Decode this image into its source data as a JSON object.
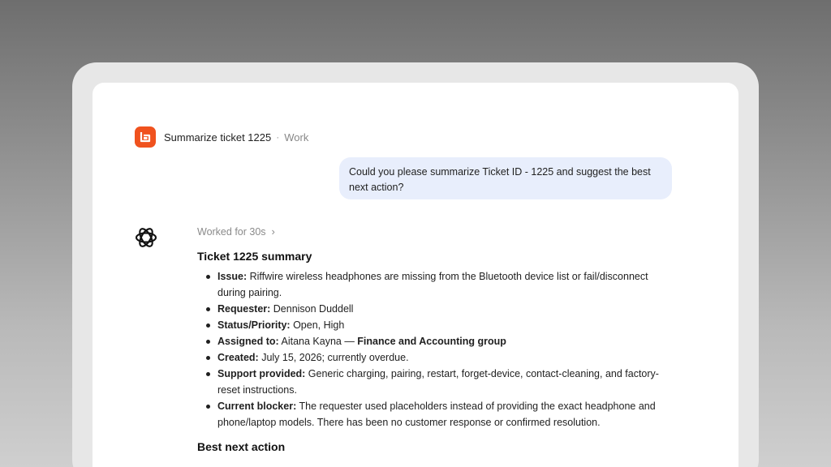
{
  "header": {
    "title": "Summarize ticket 1225",
    "separator": "·",
    "project": "Work",
    "logo_icon": "app-logo-icon",
    "logo_color": "#f0521e"
  },
  "user_message": {
    "text": "Could you please summarize Ticket ID - 1225 and suggest the best next action?"
  },
  "assistant": {
    "avatar_icon": "openai-logo-icon",
    "worked_label": "Worked for 30s",
    "section_title": "Ticket 1225 summary",
    "items": [
      {
        "label": "Issue:",
        "text": " Riffwire wireless headphones are missing from the Bluetooth device list or fail/disconnect during pairing."
      },
      {
        "label": "Requester:",
        "text": " Dennison Duddell"
      },
      {
        "label": "Status/Priority:",
        "text": " Open, High"
      },
      {
        "label": "Assigned to:",
        "text": " Aitana Kayna — ",
        "bold_tail": "Finance and Accounting group"
      },
      {
        "label": "Created:",
        "text": " July 15, 2026; currently overdue."
      },
      {
        "label": "Support provided:",
        "text": " Generic charging, pairing, restart, forget-device, contact-cleaning, and factory-reset instructions."
      },
      {
        "label": "Current blocker:",
        "text": " The requester used placeholders instead of providing the exact headphone and phone/laptop models. There has been no customer response or confirmed resolution."
      }
    ],
    "next_title": "Best next action"
  },
  "colors": {
    "user_bubble": "#e8eefc",
    "accent": "#f0521e"
  }
}
